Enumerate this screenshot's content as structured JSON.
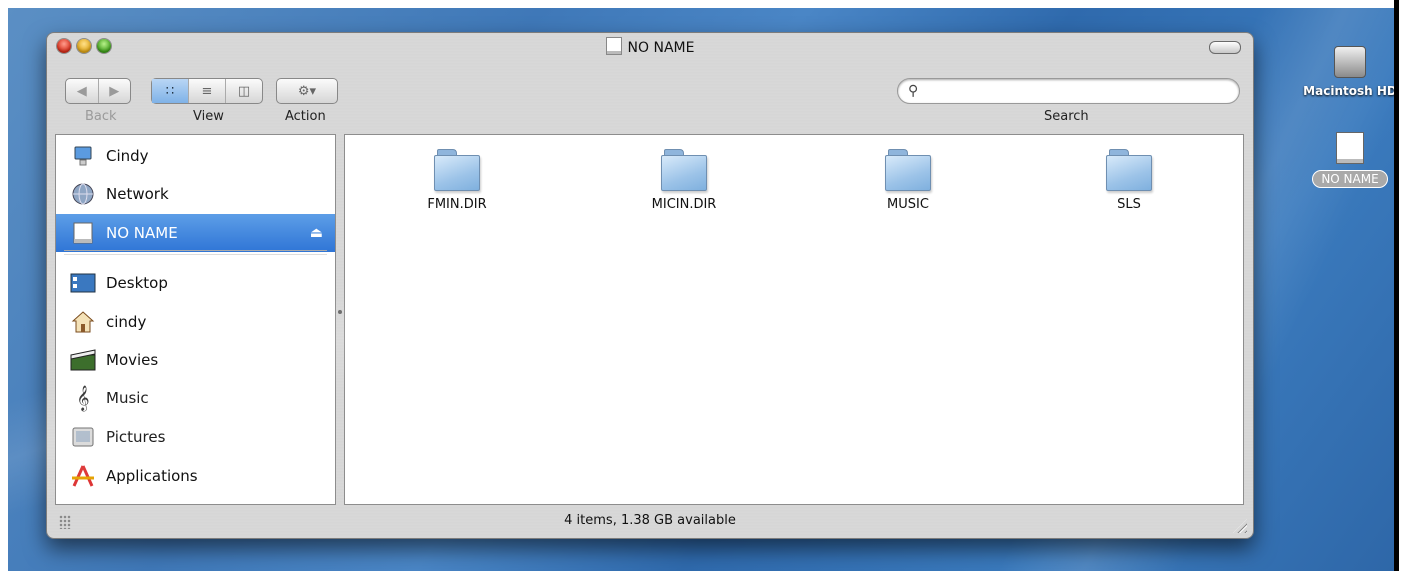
{
  "window": {
    "title": "NO NAME"
  },
  "toolbar": {
    "back_label": "Back",
    "view_label": "View",
    "action_label": "Action",
    "search_label": "Search",
    "search_value": "",
    "search_placeholder": ""
  },
  "sidebar": {
    "devices": [
      {
        "label": "Cindy",
        "icon": "computer-icon"
      },
      {
        "label": "Network",
        "icon": "network-globe-icon"
      },
      {
        "label": "NO NAME",
        "icon": "disk-icon",
        "selected": true,
        "ejectable": true
      }
    ],
    "places": [
      {
        "label": "Desktop",
        "icon": "desktop-icon"
      },
      {
        "label": "cindy",
        "icon": "home-icon"
      },
      {
        "label": "Movies",
        "icon": "movies-icon"
      },
      {
        "label": "Music",
        "icon": "music-icon"
      },
      {
        "label": "Pictures",
        "icon": "pictures-icon"
      },
      {
        "label": "Applications",
        "icon": "applications-icon"
      }
    ]
  },
  "files": [
    {
      "name": "FMIN.DIR",
      "icon": "folder-icon"
    },
    {
      "name": "MICIN.DIR",
      "icon": "folder-icon"
    },
    {
      "name": "MUSIC",
      "icon": "folder-icon"
    },
    {
      "name": "SLS",
      "icon": "folder-icon"
    }
  ],
  "status": {
    "text": "4 items, 1.38 GB available"
  },
  "desktop_icons": [
    {
      "label": "Macintosh HD",
      "icon": "hard-drive-icon"
    },
    {
      "label": "NO NAME",
      "icon": "disk-icon",
      "selected": true
    }
  ],
  "colors": {
    "selection": "#2f75d6",
    "desktop": "#3f78b8"
  }
}
